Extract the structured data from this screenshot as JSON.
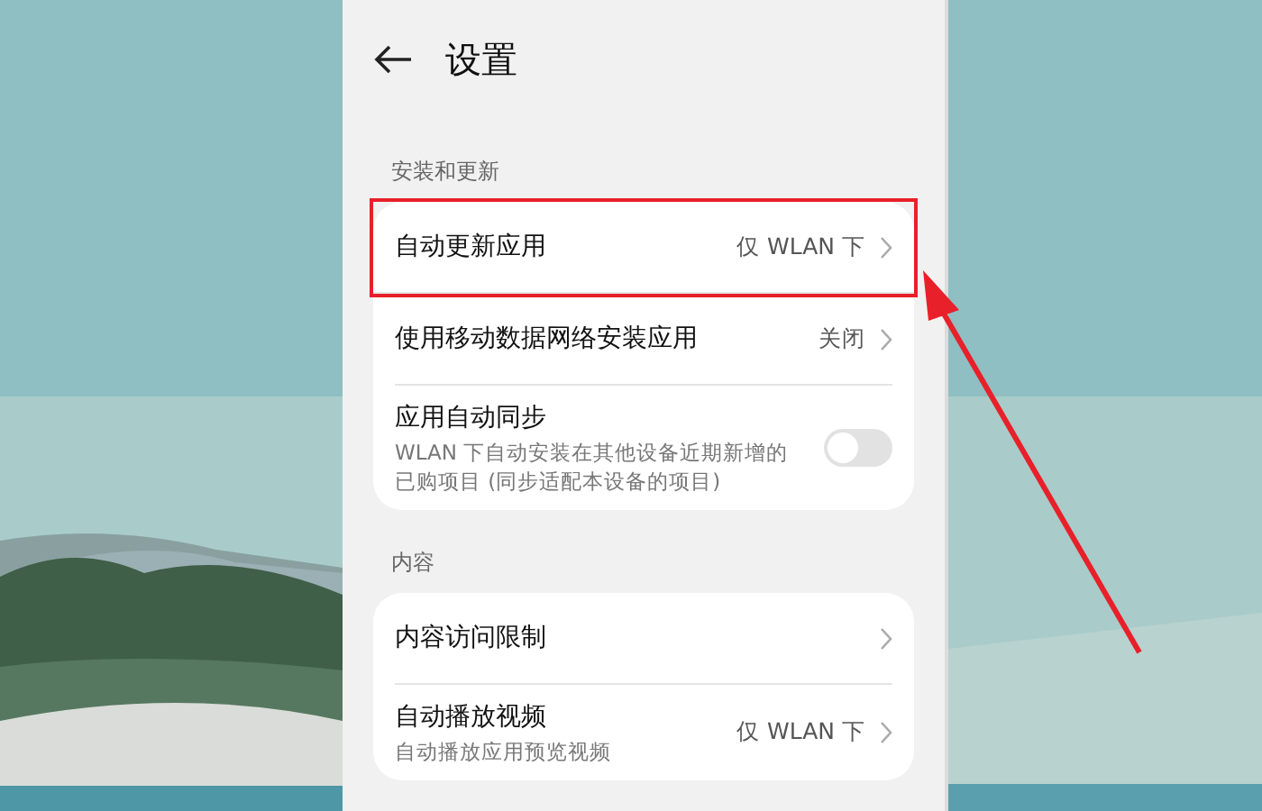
{
  "header": {
    "title": "设置"
  },
  "sections": [
    {
      "title": "安装和更新",
      "items": [
        {
          "kind": "link",
          "label": "自动更新应用",
          "value": "仅 WLAN 下",
          "highlighted": true
        },
        {
          "kind": "link",
          "label": "使用移动数据网络安装应用",
          "value": "关闭",
          "highlighted": false
        },
        {
          "kind": "toggle",
          "label": "应用自动同步",
          "description": "WLAN 下自动安装在其他设备近期新增的已购项目 (同步适配本设备的项目)",
          "on": false
        }
      ]
    },
    {
      "title": "内容",
      "items": [
        {
          "kind": "link",
          "label": "内容访问限制",
          "highlighted": false
        },
        {
          "kind": "link",
          "label": "自动播放视频",
          "description": "自动播放应用预览视频",
          "value": "仅 WLAN 下",
          "highlighted": false
        }
      ]
    }
  ]
}
